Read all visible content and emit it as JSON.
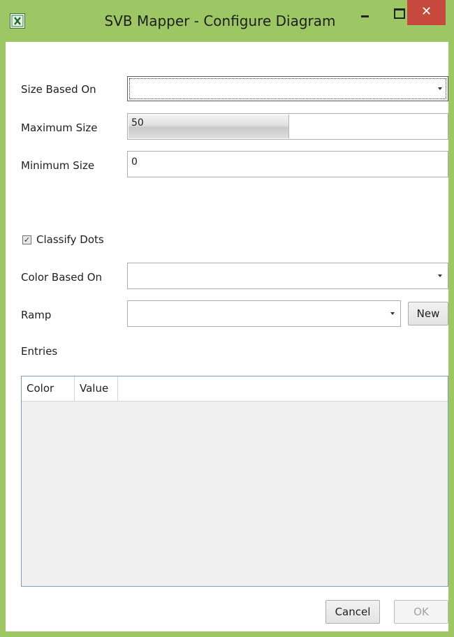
{
  "window": {
    "title": "SVB Mapper - Configure Diagram",
    "close_glyph": "✕",
    "accent_color": "#9dc764",
    "close_color": "#c7483d"
  },
  "form": {
    "size_based_on": {
      "label": "Size Based On",
      "value": ""
    },
    "maximum_size": {
      "label": "Maximum Size",
      "value": "50",
      "fill_fraction": 0.5
    },
    "minimum_size": {
      "label": "Minimum Size",
      "value": "0"
    },
    "classify_dots": {
      "label": "Classify Dots",
      "checked": true,
      "check_glyph": "✓"
    },
    "color_based_on": {
      "label": "Color Based On",
      "value": ""
    },
    "ramp": {
      "label": "Ramp",
      "value": "",
      "new_button": "New"
    },
    "entries": {
      "label": "Entries",
      "columns": [
        "Color",
        "Value"
      ],
      "rows": []
    }
  },
  "footer": {
    "cancel": "Cancel",
    "ok": "OK"
  },
  "icons": {
    "app": "excel-icon",
    "minimize": "minimize-icon",
    "maximize": "maximize-icon",
    "close": "close-icon",
    "dropdown": "chevron-down-icon"
  }
}
